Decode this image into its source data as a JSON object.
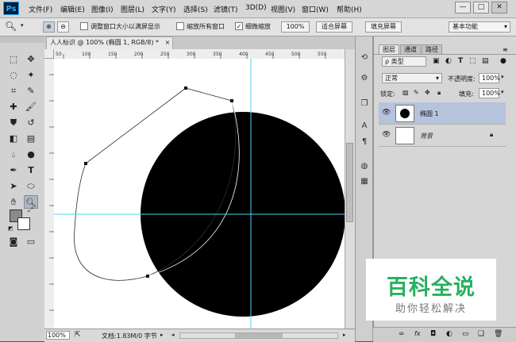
{
  "app": {
    "logo": "Ps"
  },
  "menu": [
    "文件(F)",
    "编辑(E)",
    "图像(I)",
    "图层(L)",
    "文字(Y)",
    "选择(S)",
    "滤镜(T)",
    "3D(D)",
    "视图(V)",
    "窗口(W)",
    "帮助(H)"
  ],
  "window_buttons": {
    "minimize": "—",
    "maximize": "□",
    "close": "✕"
  },
  "options_bar": {
    "tool_icon": "zoom-icon",
    "zoom_in": "⊕",
    "zoom_out": "⊖",
    "resize_windows_label": "调整窗口大小以满屏显示",
    "zoom_all_windows_label": "缩放所有窗口",
    "scrubby_zoom_label": "细微缩放",
    "scrubby_checked": "✓",
    "btn_100": "100%",
    "btn_fit": "适合屏幕",
    "btn_fill": "填充屏幕",
    "workspace": "基本功能"
  },
  "document": {
    "tab_title": "人人标识 @ 100% (椭圆 1, RGB/8) *",
    "tab_close": "×",
    "ruler_marks": [
      "50",
      "100",
      "150",
      "200",
      "250",
      "300",
      "350",
      "400",
      "450",
      "500",
      "550"
    ]
  },
  "status": {
    "zoom": "100%",
    "doc_info": "文档:1.83M/0 字节"
  },
  "layers_panel": {
    "tabs": [
      "图层",
      "通道",
      "路径"
    ],
    "filter_type": "ρ 类型",
    "blend_mode": "正常",
    "opacity_label": "不透明度:",
    "opacity_value": "100%",
    "lock_label": "锁定:",
    "fill_label": "填充:",
    "fill_value": "100%",
    "layers": [
      {
        "name": "椭圆 1",
        "visible_icon": "eye-icon",
        "selected": true
      },
      {
        "name": "背景",
        "visible_icon": "eye-icon",
        "locked": true
      }
    ],
    "footer_icons": [
      "link-icon",
      "fx-icon",
      "mask-icon",
      "adjustment-icon",
      "group-icon",
      "new-layer-icon",
      "trash-icon"
    ]
  },
  "watermark": {
    "title": "百科全说",
    "subtitle": "助你轻松解决"
  },
  "colors": {
    "guide": "#4fd4f0",
    "selected_layer": "#b5c3dd",
    "watermark_green": "#27b060"
  }
}
